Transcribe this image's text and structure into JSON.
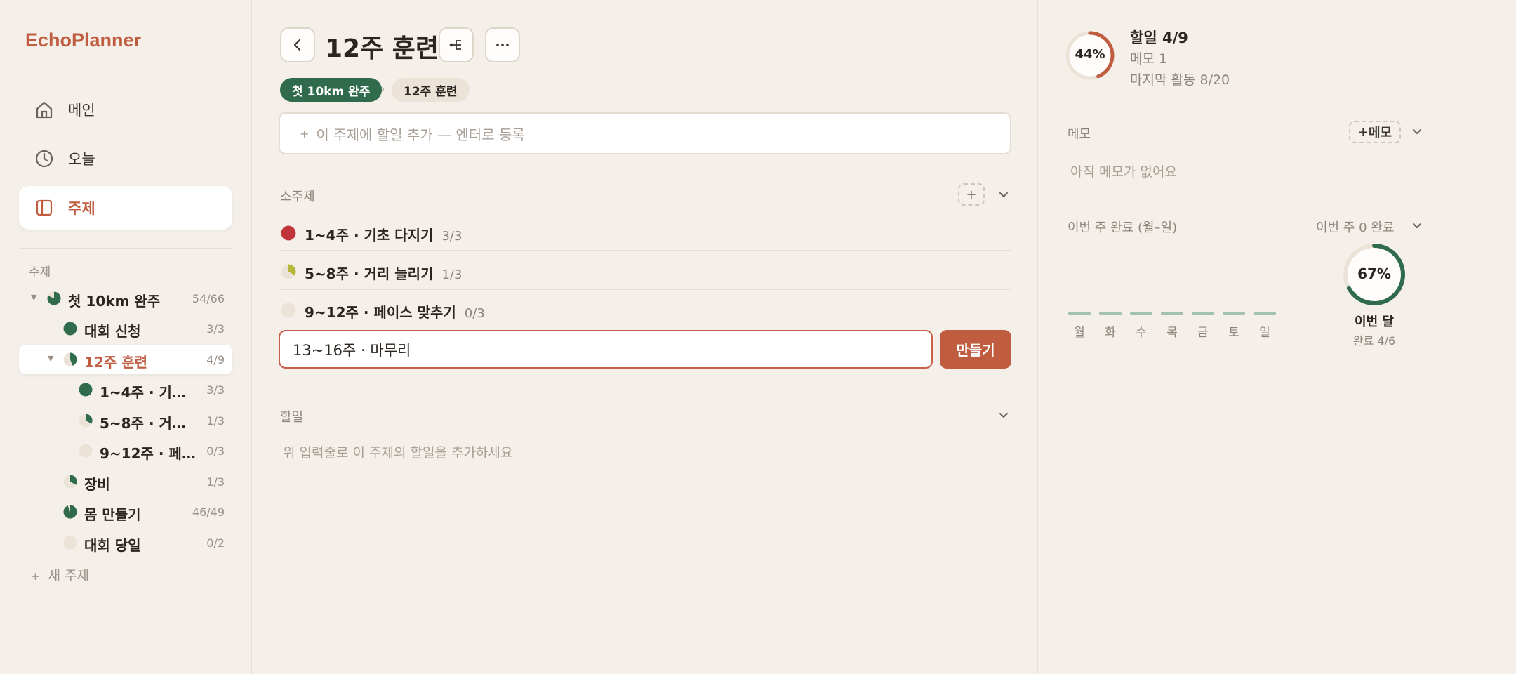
{
  "app": {
    "name": "EchoPlanner"
  },
  "nav": [
    {
      "label": "메인",
      "icon": "home-icon"
    },
    {
      "label": "오늘",
      "icon": "clock-icon"
    },
    {
      "label": "주제",
      "icon": "notebook-icon",
      "active": true
    }
  ],
  "sidebar": {
    "section_title": "주제",
    "tree": [
      {
        "label": "첫 10km 완주",
        "count": "54/66",
        "progress": 0.82
      },
      {
        "label": "대회 신청",
        "count": "3/3",
        "progress": 1.0
      },
      {
        "label": "12주 훈련",
        "count": "4/9",
        "progress": 0.44,
        "active": true
      },
      {
        "label": "1~4주 · 기초 ...",
        "count": "3/3",
        "progress": 1.0
      },
      {
        "label": "5~8주 · 거리 ...",
        "count": "1/3",
        "progress": 0.33
      },
      {
        "label": "9~12주 · 페이...",
        "count": "0/3",
        "progress": 0.0
      },
      {
        "label": "장비",
        "count": "1/3",
        "progress": 0.33
      },
      {
        "label": "몸 만들기",
        "count": "46/49",
        "progress": 0.94
      },
      {
        "label": "대회 당일",
        "count": "0/2",
        "progress": 0.0
      }
    ],
    "new_topic": "새 주제"
  },
  "main": {
    "title": "12주 훈련",
    "breadcrumb": [
      "첫 10km 완주",
      "12주 훈련"
    ],
    "task_input_placeholder": "이 주제에 할일 추가 — 엔터로 등록",
    "subtopics_title": "소주제",
    "subtopics": [
      {
        "label": "1~4주 · 기초 다지기",
        "count": "3/3",
        "progress": 1.0,
        "color": "#c0343a"
      },
      {
        "label": "5~8주 · 거리 늘리기",
        "count": "1/3",
        "progress": 0.33,
        "color": "#b5b83a"
      },
      {
        "label": "9~12주 · 페이스 맞추기",
        "count": "0/3",
        "progress": 0.0,
        "color": "#2f6b4c"
      }
    ],
    "new_subtopic_value": "13~16주 · 마무리",
    "create_label": "만들기",
    "todos_title": "할일",
    "todos_empty": "위 입력줄로 이 주제의 할일을 추가하세요"
  },
  "right": {
    "progress_pct": "44%",
    "progress": 0.44,
    "todo_stat": "할일 4/9",
    "memo_count": "메모 1",
    "last_activity": "마지막 활동 8/20",
    "memo_title": "메모",
    "memo_add": "메모",
    "memo_empty": "아직 메모가 없어요",
    "week_title": "이번 주 완료 (월–일)",
    "week_summary": "이번 주 0 완료",
    "days": [
      "월",
      "화",
      "수",
      "목",
      "금",
      "토",
      "일"
    ],
    "day_values": [
      0,
      0,
      0,
      0,
      0,
      0,
      0
    ],
    "month_pct": "67%",
    "month_progress": 0.67,
    "month_label": "이번 달",
    "month_sub": "완료 4/6"
  },
  "colors": {
    "accent": "#c05c40",
    "green": "#2f6b4c",
    "background": "#f4efe9"
  }
}
